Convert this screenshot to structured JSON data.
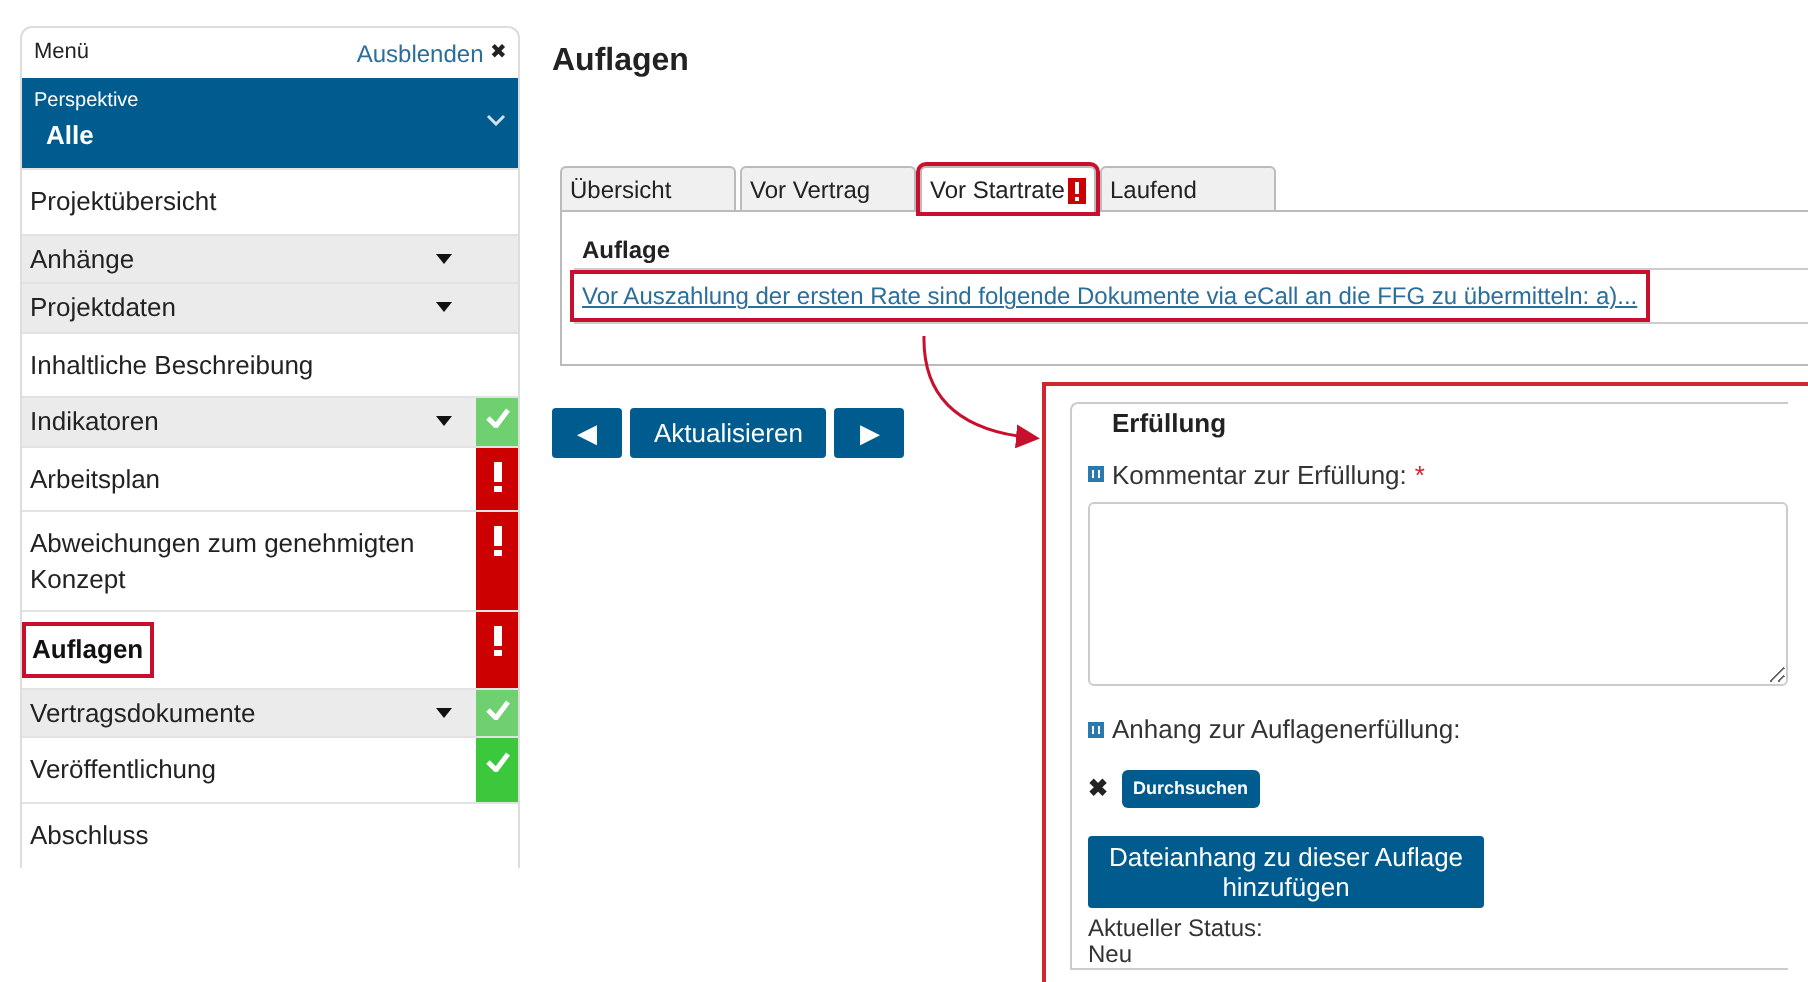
{
  "menu": {
    "title": "Menü",
    "hide_link": "Ausblenden",
    "close_glyph": "✖"
  },
  "perspective": {
    "label": "Perspektive",
    "value": "Alle"
  },
  "sidebar_items": [
    {
      "label": "Projektübersicht",
      "kind": "link",
      "done": false,
      "alert": false,
      "selected": false,
      "highlighted": false
    },
    {
      "label": "Anhänge",
      "kind": "group",
      "done": false,
      "alert": false,
      "selected": false,
      "highlighted": false
    },
    {
      "label": "Projektdaten",
      "kind": "group",
      "done": false,
      "alert": false,
      "selected": false,
      "highlighted": false
    },
    {
      "label": "Inhaltliche Beschreibung",
      "kind": "link",
      "done": false,
      "alert": false,
      "selected": false,
      "highlighted": false
    },
    {
      "label": "Indikatoren",
      "kind": "group",
      "done": true,
      "alert": false,
      "selected": false,
      "highlighted": false
    },
    {
      "label": "Arbeitsplan",
      "kind": "link",
      "done": false,
      "alert": true,
      "selected": false,
      "highlighted": false
    },
    {
      "label": "Abweichungen zum genehmigten Konzept",
      "kind": "link",
      "done": false,
      "alert": true,
      "selected": false,
      "highlighted": false
    },
    {
      "label": "Auflagen",
      "kind": "link",
      "done": false,
      "alert": true,
      "selected": true,
      "highlighted": true
    },
    {
      "label": "Vertragsdokumente",
      "kind": "group",
      "done": true,
      "alert": false,
      "selected": false,
      "highlighted": false
    },
    {
      "label": "Veröffentlichung",
      "kind": "link",
      "done": true,
      "alert": false,
      "selected": false,
      "highlighted": false
    },
    {
      "label": "Abschluss",
      "kind": "link",
      "done": false,
      "alert": false,
      "selected": false,
      "highlighted": false
    }
  ],
  "page_title": "Auflagen",
  "tabs": [
    {
      "label": "Übersicht",
      "selected": false,
      "alert": false,
      "highlighted": false
    },
    {
      "label": "Vor Vertrag",
      "selected": false,
      "alert": false,
      "highlighted": false
    },
    {
      "label": "Vor Startrate",
      "selected": true,
      "alert": true,
      "highlighted": true
    },
    {
      "label": "Laufend",
      "selected": false,
      "alert": false,
      "highlighted": false
    }
  ],
  "condition": {
    "heading": "Auflage",
    "link": "Vor Auszahlung der ersten Rate sind folgende Dokumente via eCall an die FFG zu übermitteln: a)...",
    "highlighted": true
  },
  "nav_buttons": [
    "◀",
    "Aktualisieren",
    "▶"
  ],
  "annotation_arrow": true,
  "fulfillment": {
    "legend": "Erfüllung",
    "highlighted": true,
    "comment_label": "Kommentar zur Erfüllung:",
    "required_mark": "*",
    "attachment_label": "Anhang zur Auflagenerfüllung:",
    "remove_glyph": "✖",
    "browse_button": "Durchsuchen",
    "add_button": "Dateianhang zu dieser Auflage hinzufügen",
    "status_label": "Aktueller Status:",
    "status_value": "Neu"
  }
}
